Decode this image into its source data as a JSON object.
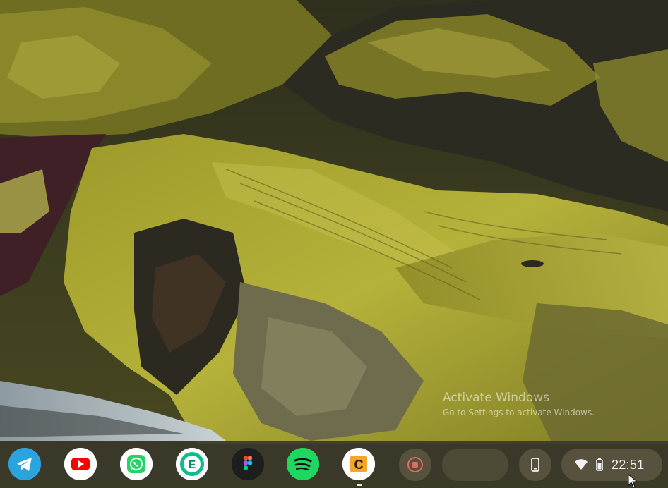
{
  "wallpaper": {
    "name": "mountain-landscape-wallpaper"
  },
  "watermark": {
    "title": "Activate Windows",
    "subtitle": "Go to Settings to activate Windows."
  },
  "shelf": {
    "apps": [
      {
        "name": "Telegram",
        "icon": "telegram-icon",
        "color": "#2aa3de"
      },
      {
        "name": "YouTube",
        "icon": "youtube-icon",
        "color": "#ff0000"
      },
      {
        "name": "WhatsApp",
        "icon": "whatsapp-icon",
        "color": "#25d366"
      },
      {
        "name": "Element",
        "icon": "element-icon",
        "color": "#0dbd8b"
      },
      {
        "name": "Figma",
        "icon": "figma-icon",
        "color": "#1e1e1e"
      },
      {
        "name": "Spotify",
        "icon": "spotify-icon",
        "color": "#1ed760"
      },
      {
        "name": "C",
        "icon": "c-app-icon",
        "color": "#f5a623"
      }
    ],
    "screen_record_icon": "record-icon",
    "phone_hub_icon": "phone-icon",
    "status": {
      "wifi_icon": "wifi-icon",
      "battery_icon": "battery-icon",
      "time": "22:51"
    }
  }
}
